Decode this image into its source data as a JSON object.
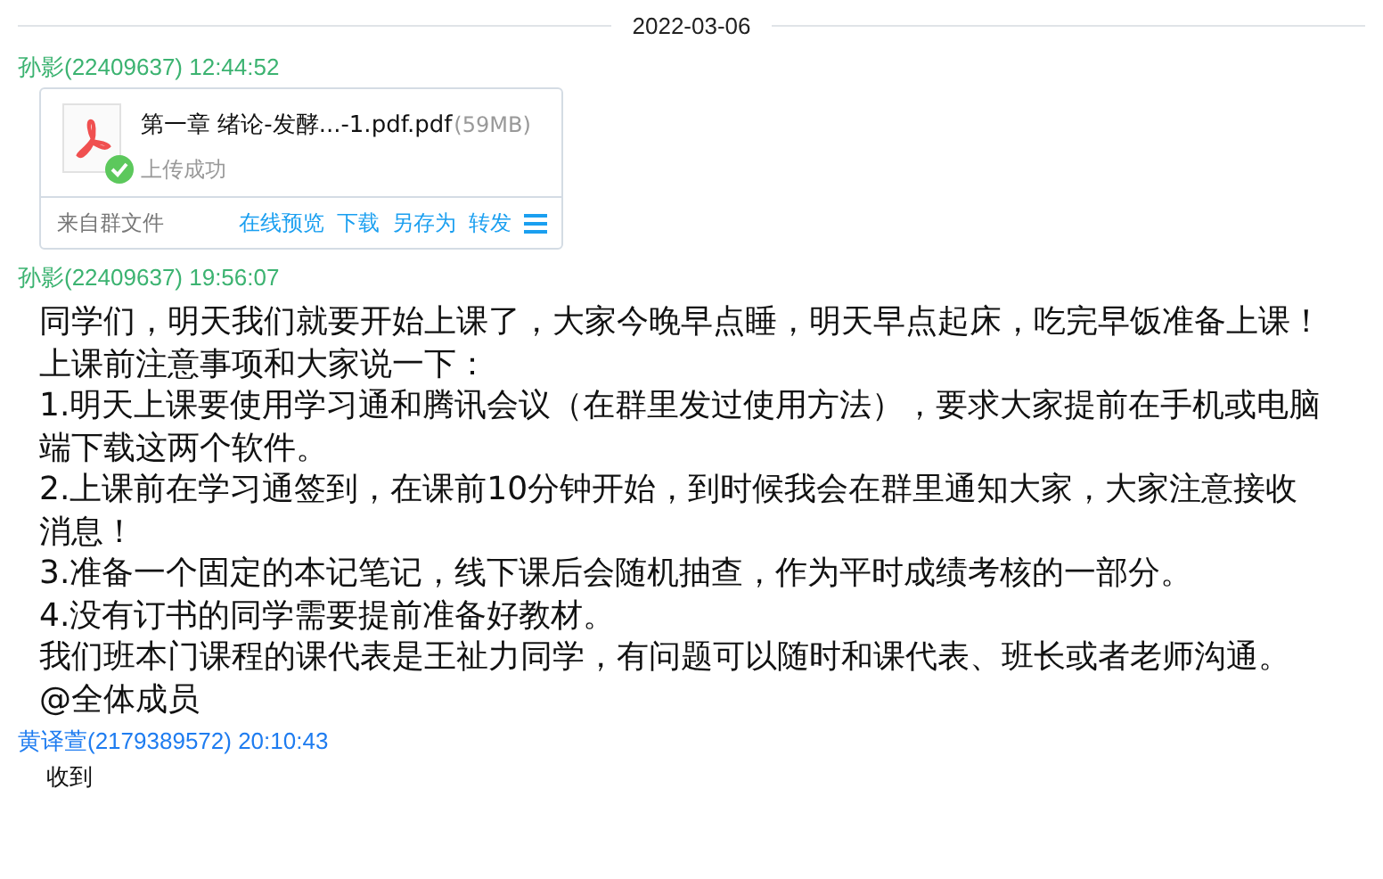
{
  "date_divider": "2022-03-06",
  "messages": [
    {
      "kind": "file",
      "sender": "孙影(22409637) 12:44:52",
      "color": "#3cb371",
      "file": {
        "name": "第一章 绪论-发酵...-1.pdf.pdf",
        "size": "(59MB)",
        "status": "上传成功",
        "uploaded": true,
        "source": "来自群文件",
        "actions": [
          "在线预览",
          "下载",
          "另存为",
          "转发"
        ]
      }
    },
    {
      "kind": "announcement",
      "sender": "孙影(22409637) 19:56:07",
      "color": "#3cb371",
      "paragraphs": [
        "同学们，明天我们就要开始上课了，大家今晚早点睡，明天早点起床，吃完早饭准备上课！",
        "上课前注意事项和大家说一下：",
        "1.明天上课要使用学习通和腾讯会议（在群里发过使用方法），要求大家提前在手机或电脑端下载这两个软件。",
        "2.上课前在学习通签到，在课前10分钟开始，到时候我会在群里通知大家，大家注意接收消息！",
        "3.准备一个固定的本记笔记，线下课后会随机抽查，作为平时成绩考核的一部分。",
        "4.没有订书的同学需要提前准备好教材。",
        "我们班本门课程的课代表是王祉力同学，有问题可以随时和课代表、班长或者老师沟通。",
        "@全体成员"
      ]
    },
    {
      "kind": "text",
      "sender": "黄译萱(2179389572) 20:10:43",
      "color": "#1e7cf0",
      "paragraphs": [
        "收到"
      ]
    }
  ]
}
